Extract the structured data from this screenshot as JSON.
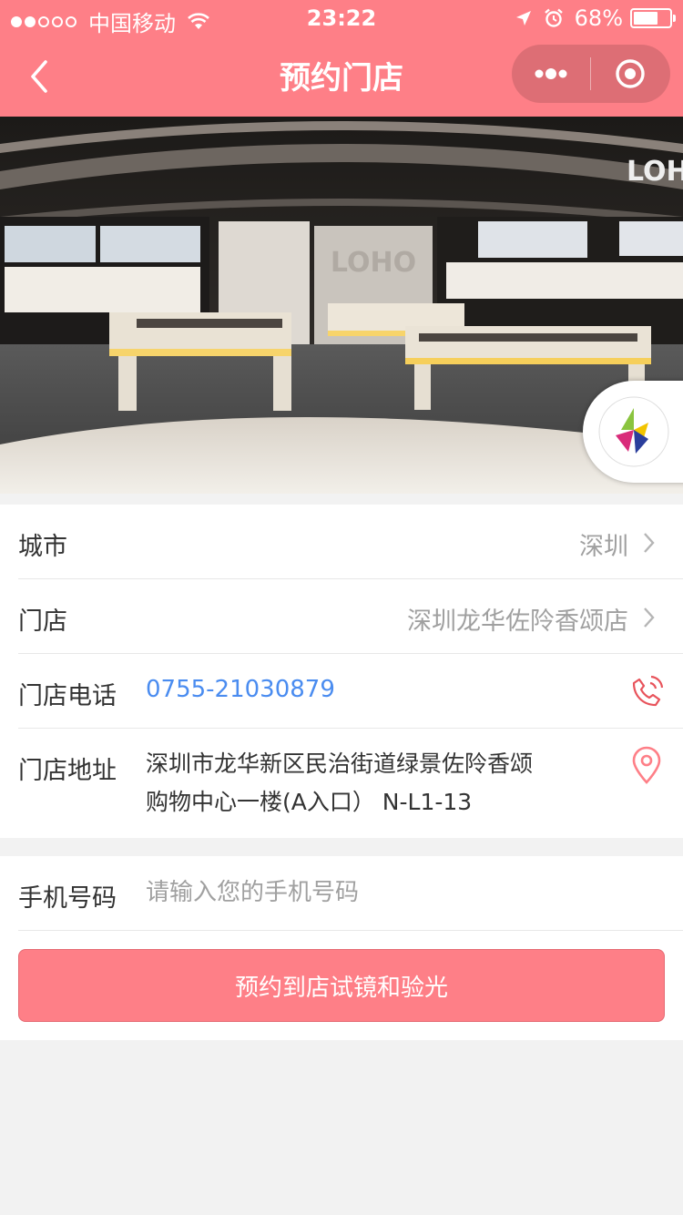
{
  "status_bar": {
    "carrier": "中国移动",
    "time": "23:22",
    "battery": "68%",
    "battery_level": 0.68
  },
  "nav": {
    "title": "预约门店"
  },
  "store_info": {
    "city_label": "城市",
    "city_value": "深圳",
    "store_label": "门店",
    "store_value": "深圳龙华佐阾香颂店",
    "phone_label": "门店电话",
    "phone_value": "0755-21030879",
    "address_label": "门店地址",
    "address_value": "深圳市龙华新区民治街道绿景佐阾香颂购物中心一楼(A入口） N-L1-13"
  },
  "form": {
    "mobile_label": "手机号码",
    "mobile_placeholder": "请输入您的手机号码",
    "mobile_value": "",
    "submit_label": "预约到店试镜和验光"
  },
  "colors": {
    "brand": "#fe7f87",
    "link": "#4a8cf0",
    "icon_red": "#e8535b"
  },
  "icons": {
    "back": "chevron-left-icon",
    "more": "more-dots-icon",
    "close": "target-close-icon",
    "chevron": "chevron-right-icon",
    "phone": "phone-ringing-icon",
    "location": "location-pin-icon"
  }
}
